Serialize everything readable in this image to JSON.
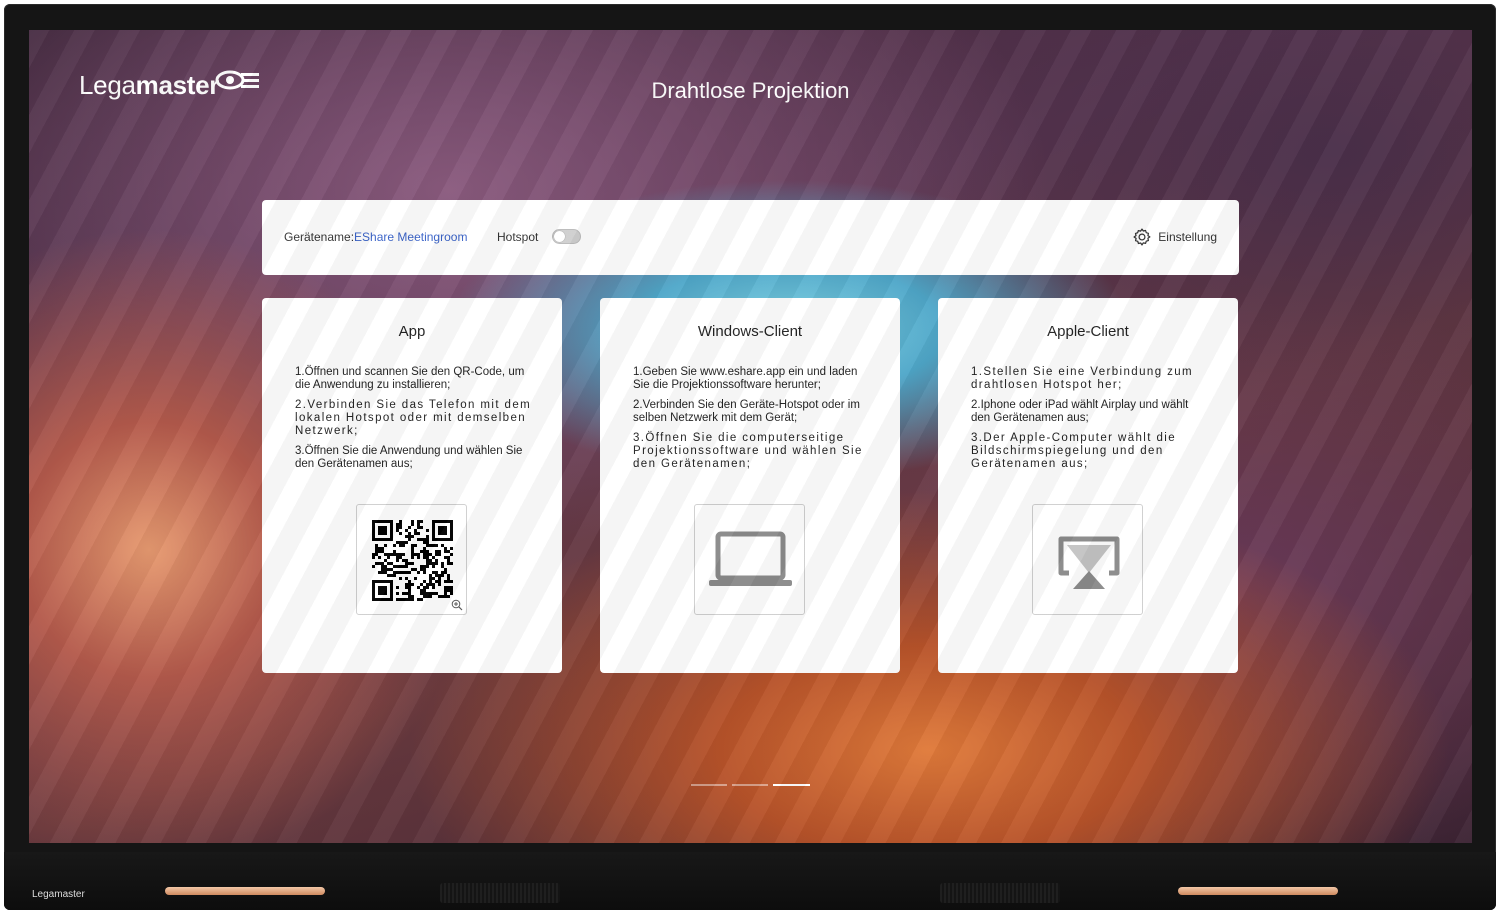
{
  "brand": {
    "logo_light": "Lega",
    "logo_bold": "master",
    "bezel_logo": "Legamaster"
  },
  "screen_title": "Drahtlose Projektion",
  "topbar": {
    "device_label": "Gerätename:",
    "device_name": "EShare Meetingroom",
    "hotspot_label": "Hotspot",
    "hotspot_on": false,
    "settings_label": "Einstellung"
  },
  "cards": [
    {
      "title": "App",
      "steps": [
        "1.Öffnen und scannen Sie den QR-Code, um die Anwendung zu installieren;",
        "2.Verbinden Sie das Telefon mit dem lokalen Hotspot oder mit demselben Netzwerk;",
        "3.Öffnen Sie die Anwendung und wählen Sie den Gerätenamen aus;"
      ],
      "icon": "qr-code-icon"
    },
    {
      "title": "Windows-Client",
      "steps": [
        "1.Geben Sie www.eshare.app ein und laden Sie die Projektionssoftware herunter;",
        "2.Verbinden Sie den Geräte-Hotspot oder im selben Netzwerk mit dem Gerät;",
        "3.Öffnen Sie die computerseitige Projektionssoftware und wählen Sie den Gerätenamen;"
      ],
      "icon": "laptop-icon"
    },
    {
      "title": "Apple-Client",
      "steps": [
        "1.Stellen Sie eine Verbindung zum drahtlosen Hotspot her;",
        "2.Iphone oder iPad wählt Airplay und wählt den Gerätenamen aus;",
        "3.Der Apple-Computer wählt die Bildschirmspiegelung und den Gerätenamen aus;"
      ],
      "icon": "airplay-icon"
    }
  ],
  "pager": {
    "pages": 3,
    "active": 3
  },
  "colors": {
    "accent_link": "#3a63c8",
    "card_bg": "#ffffff",
    "frame": "#151515"
  }
}
